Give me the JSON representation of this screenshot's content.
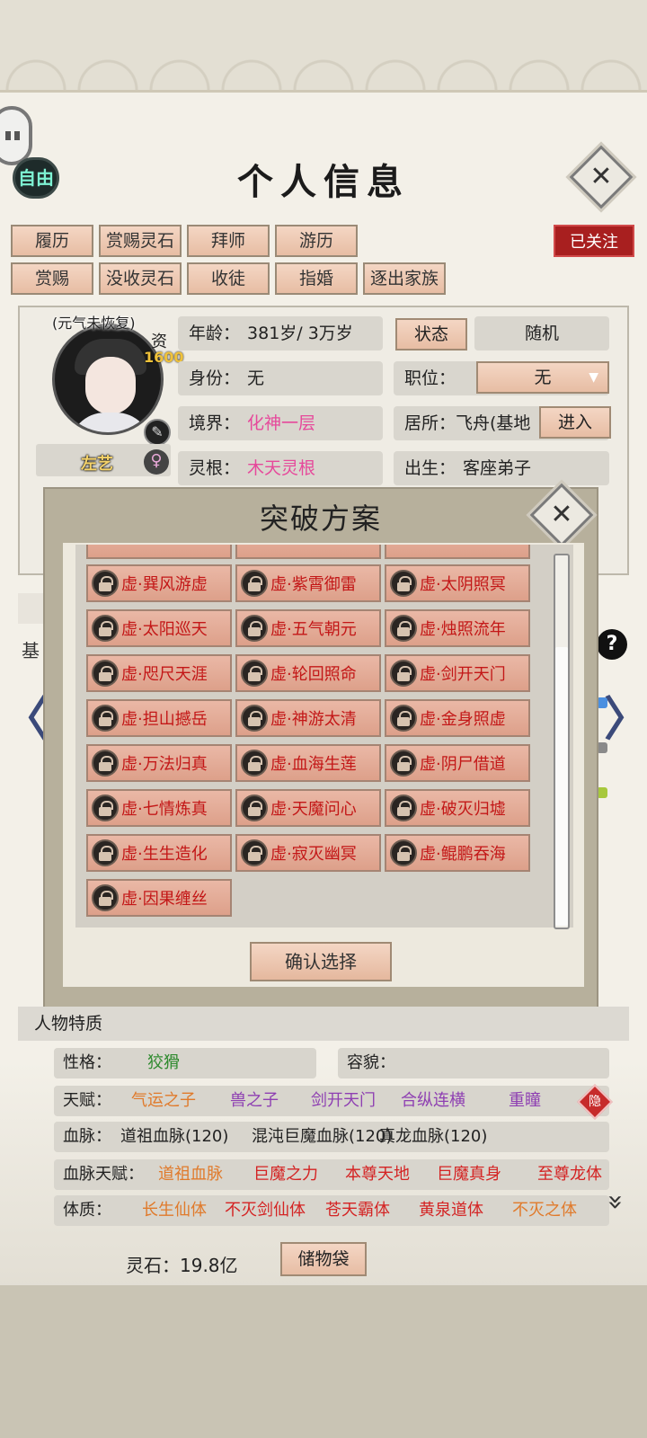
{
  "header": {
    "title": "个人信息",
    "free_badge": "自由",
    "followed": "已关注",
    "close_symbol": "✕"
  },
  "actions": {
    "row1": [
      "履历",
      "赏赐灵石",
      "拜师",
      "游历"
    ],
    "row2": [
      "赏赐",
      "没收灵石",
      "收徒",
      "指婚",
      "逐出家族"
    ]
  },
  "profile": {
    "status_note": "(元气未恢复)",
    "zi_label": "资",
    "zi_value": "1600",
    "name": "左艺",
    "gender_icon": "female-icon",
    "age_label": "年龄：",
    "age_value": "381岁/ 3万岁",
    "state_button": "状态",
    "random_button": "随机",
    "identity_label": "身份：",
    "identity_value": "无",
    "position_label": "职位：",
    "position_value": "无",
    "realm_label": "境界：",
    "realm_value": "化神一层",
    "residence_label": "居所：",
    "residence_value": "飞舟(基地",
    "enter_button": "进入",
    "root_label": "灵根：",
    "root_value": "木天灵根",
    "birth_label": "出生：",
    "birth_value": "客座弟子",
    "partial_tab": "基"
  },
  "modal": {
    "title": "突破方案",
    "confirm": "确认选择",
    "skills": [
      [
        "虚·巽风游虚",
        "虚·紫霄御雷",
        "虚·太阴照冥"
      ],
      [
        "虚·太阳巡天",
        "虚·五气朝元",
        "虚·烛照流年"
      ],
      [
        "虚·咫尺天涯",
        "虚·轮回照命",
        "虚·剑开天门"
      ],
      [
        "虚·担山撼岳",
        "虚·神游太清",
        "虚·金身照虚"
      ],
      [
        "虚·万法归真",
        "虚·血海生莲",
        "虚·阴尸借道"
      ],
      [
        "虚·七情炼真",
        "虚·天魔问心",
        "虚·破灭归墟"
      ],
      [
        "虚·生生造化",
        "虚·寂灭幽冥",
        "虚·鲲鹏吞海"
      ],
      [
        "虚·因果缠丝"
      ]
    ]
  },
  "traits": {
    "header": "人物特质",
    "personality_label": "性格：",
    "personality_value": "狡猾",
    "appearance_label": "容貌：",
    "talent_label": "天赋：",
    "talents": [
      "气运之子",
      "兽之子",
      "剑开天门",
      "合纵连横",
      "重瞳"
    ],
    "hidden_badge": "隐",
    "bloodline_label": "血脉：",
    "bloodlines": [
      "道祖血脉(120)",
      "混沌巨魔血脉(120)",
      "真龙血脉(120)"
    ],
    "bloodline_talent_label": "血脉天赋：",
    "bloodline_talents": [
      "道祖血脉",
      "巨魔之力",
      "本尊天地",
      "巨魔真身",
      "至尊龙体"
    ],
    "physique_label": "体质：",
    "physiques": [
      "长生仙体",
      "不灭剑仙体",
      "苍天霸体",
      "黄泉道体",
      "不灭之体"
    ]
  },
  "footer": {
    "stones_label": "灵石：19.8亿",
    "bag_button": "储物袋"
  },
  "icons": {
    "left_arrow": "〈",
    "right_arrow": "〉",
    "help": "?",
    "pen": "✎",
    "female": "♀",
    "expand": "»",
    "select_chevron": "▼"
  }
}
